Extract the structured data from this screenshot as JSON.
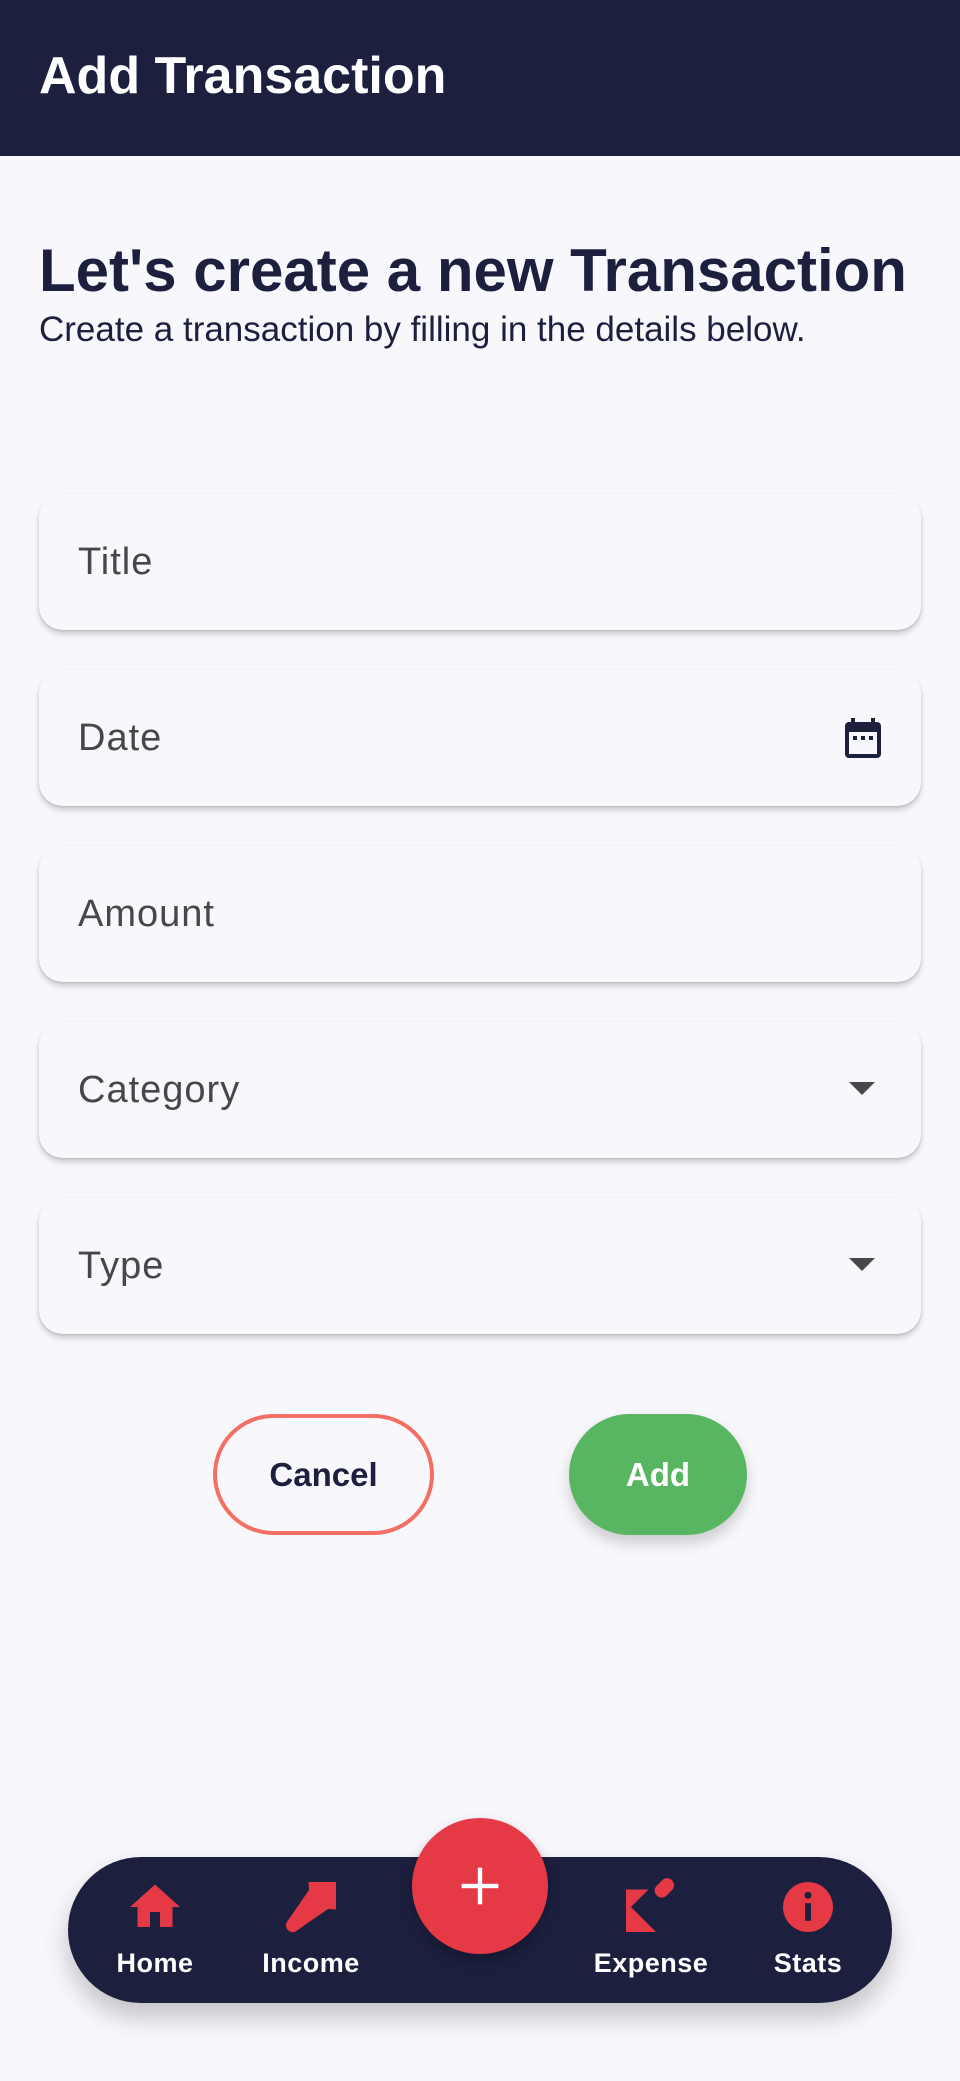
{
  "app_bar": {
    "title": "Add Transaction"
  },
  "form": {
    "heading": "Let's create a new Transaction",
    "subheading": "Create a transaction by filling in the details below.",
    "fields": {
      "title": {
        "label": "Title"
      },
      "date": {
        "label": "Date",
        "icon": "calendar-icon"
      },
      "amount": {
        "label": "Amount"
      },
      "category": {
        "label": "Category",
        "icon": "dropdown-arrow-icon"
      },
      "type": {
        "label": "Type",
        "icon": "dropdown-arrow-icon"
      }
    },
    "buttons": {
      "cancel": "Cancel",
      "add": "Add"
    }
  },
  "bottom_nav": {
    "items": [
      {
        "label": "Home",
        "icon": "home-icon"
      },
      {
        "label": "Income",
        "icon": "income-arrow-icon"
      },
      {
        "label": "Expense",
        "icon": "expense-icon"
      },
      {
        "label": "Stats",
        "icon": "info-icon"
      }
    ],
    "fab_icon": "plus-icon"
  },
  "colors": {
    "primary_dark": "#1c1f3e",
    "accent_red": "#e63946",
    "add_green": "#58b561",
    "cancel_border": "#f46f63",
    "background": "#f8f7fc"
  }
}
